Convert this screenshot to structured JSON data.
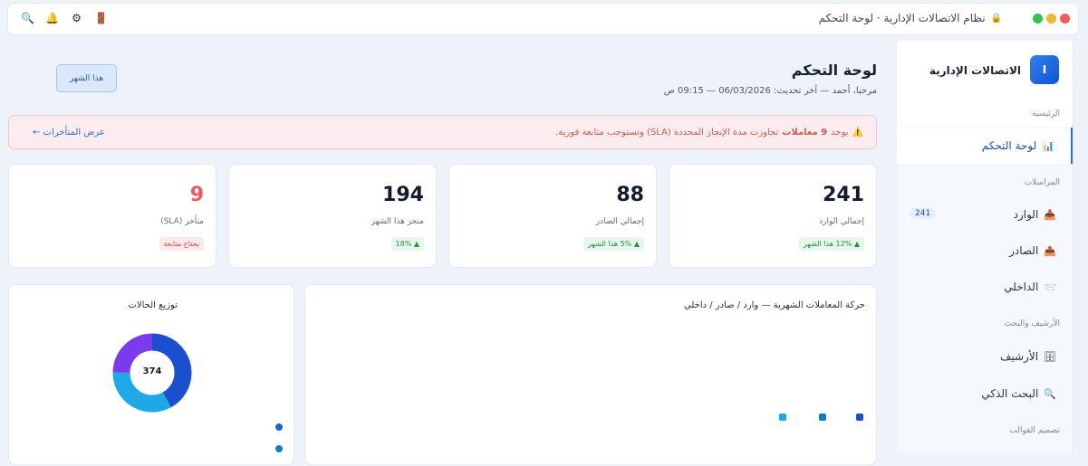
{
  "window": {
    "title": "نظام الاتصالات الإدارية · لوحة التحكم",
    "dots": [
      "#f25c5c",
      "#f5b62e",
      "#2fc44f"
    ]
  },
  "toolbar": {
    "icons": [
      "search-icon",
      "bell-icon",
      "gear-icon",
      "door-icon"
    ],
    "glyphs": {
      "search": "🔍",
      "bell": "🔔",
      "gear": "⚙",
      "door": "🚪",
      "lock": "🔒"
    }
  },
  "sidebar": {
    "brand_letter": "I",
    "brand_name": "الاتصالات الإدارية",
    "sections": {
      "main": "الرئيسية",
      "correspondence": "المراسلات",
      "archive_search": "الأرشيف والبحث",
      "templates": "تصميم القوالب"
    },
    "items": [
      {
        "label": "لوحة التحكم",
        "icon": "📊",
        "active": true
      },
      {
        "label": "الوارد",
        "icon": "📥",
        "badge": "241"
      },
      {
        "label": "الصادر",
        "icon": "📤"
      },
      {
        "label": "الداخلي",
        "icon": "📨"
      },
      {
        "label": "الأرشيف",
        "icon": "🗄"
      },
      {
        "label": "البحث الذكي",
        "icon": "🔍"
      }
    ]
  },
  "header": {
    "title": "لوحة التحكم",
    "welcome": "مرحبا، أحمد — آخر تحديث: 06/03/2026 — 09:15 ص",
    "period_button": "هذا الشهر"
  },
  "alert": {
    "icon": "⚠️",
    "prefix": "يوجد",
    "count": "9 معاملات",
    "text": "تجاوزت مدة الإنجاز المحددة (SLA) وتستوجب متابعة فورية.",
    "link": "عرض المتأخرات ←"
  },
  "stats": [
    {
      "value": "241",
      "label": "إجمالي الوارد",
      "chip": "▲ 12% هذا الشهر",
      "value_color": "#131c2a",
      "chip_type": "green"
    },
    {
      "value": "88",
      "label": "إجمالي الصادر",
      "chip": "▲ 5% هذا الشهر",
      "value_color": "#131c2a",
      "chip_type": "green"
    },
    {
      "value": "194",
      "label": "منجز هذا الشهر",
      "chip": "▲ 18%",
      "value_color": "#131c2a",
      "chip_type": "green"
    },
    {
      "value": "9",
      "label": "متأخر (SLA)",
      "chip": "يحتاج متابعة",
      "value_color": "#f05a5a",
      "chip_type": "red"
    }
  ],
  "movement_panel": {
    "title": "حركة المعاملات الشهرية — وارد / صادر / داخلي",
    "legend_colors": [
      "#1a4fd0",
      "#0f7fbf",
      "#1ca9e6"
    ]
  },
  "status_panel": {
    "title": "توزيع الحالات",
    "total": "374",
    "legend_colors": [
      "#1466d8",
      "#0f7fbf"
    ]
  },
  "chart_data": {
    "type": "pie",
    "title": "توزيع الحالات",
    "center_label": "374",
    "slices": [
      {
        "value": 0.42,
        "color": "#1a4fd0"
      },
      {
        "value": 0.33,
        "color": "#1ca9e6"
      },
      {
        "value": 0.25,
        "color": "#7c3aed"
      }
    ]
  }
}
